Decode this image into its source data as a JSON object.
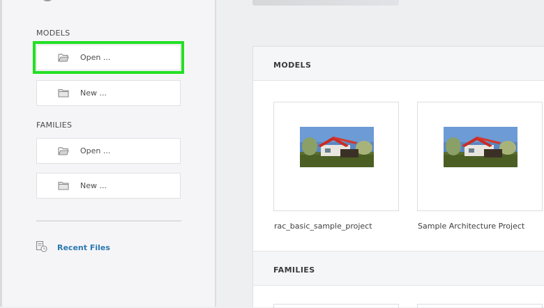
{
  "sidebar": {
    "models_heading": "MODELS",
    "models_open": "Open ...",
    "models_new": "New ...",
    "families_heading": "FAMILIES",
    "families_open": "Open ...",
    "families_new": "New ...",
    "recent_files": "Recent Files",
    "highlight_color": "#22e022"
  },
  "main": {
    "models_section_title": "MODELS",
    "families_section_title": "FAMILIES",
    "models": [
      {
        "name": "rac_basic_sample_project",
        "thumbnail": "house-render-thumbnail"
      },
      {
        "name": "Sample Architecture Project",
        "thumbnail": "house-render-thumbnail"
      }
    ]
  },
  "colors": {
    "link": "#2b78b0",
    "accent_highlight": "#22e022"
  }
}
